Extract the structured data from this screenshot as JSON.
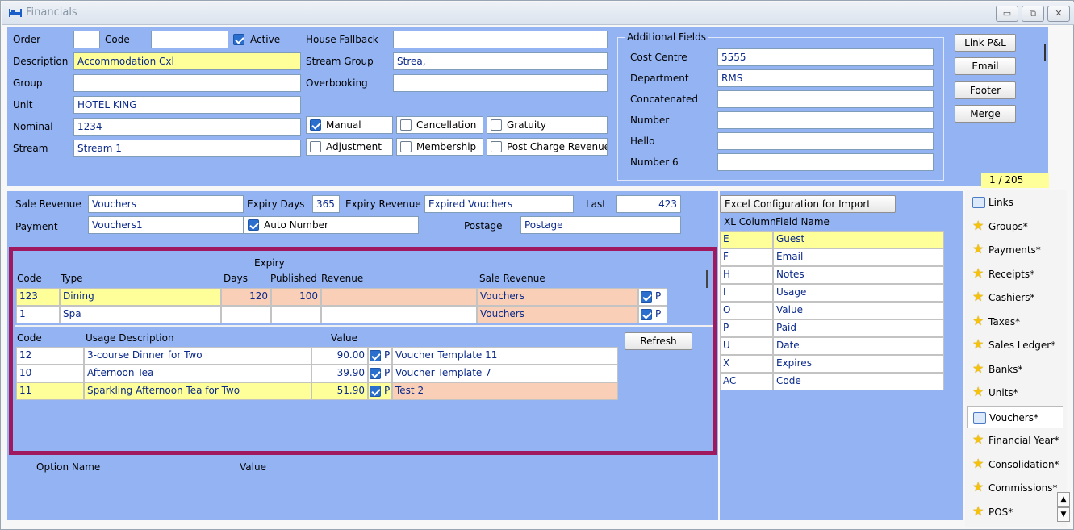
{
  "window": {
    "title": "Financials",
    "minimize": "▭",
    "restore": "⧉",
    "close": "✕"
  },
  "top": {
    "order_label": "Order",
    "order_value": "",
    "code_label": "Code",
    "code_value": "",
    "active_label": "Active",
    "description_label": "Description",
    "description_value": "Accommodation Cxl",
    "group_label": "Group",
    "group_value": "",
    "unit_label": "Unit",
    "unit_value": "HOTEL KING",
    "nominal_label": "Nominal",
    "nominal_value": "1234",
    "stream_label": "Stream",
    "stream_value": "Stream 1",
    "house_fallback_label": "House Fallback",
    "house_fallback_value": "",
    "stream_group_label": "Stream Group",
    "stream_group_value": "Strea,",
    "overbooking_label": "Overbooking",
    "overbooking_value": "",
    "manual_label": "Manual",
    "cancellation_label": "Cancellation",
    "gratuity_label": "Gratuity",
    "adjustment_label": "Adjustment",
    "membership_label": "Membership",
    "post_charge_label": "Post Charge Revenue"
  },
  "additional": {
    "title": "Additional Fields",
    "fields": [
      {
        "label": "Cost Centre",
        "value": "5555"
      },
      {
        "label": "Department",
        "value": "RMS"
      },
      {
        "label": "Concatenated",
        "value": ""
      },
      {
        "label": "Number",
        "value": ""
      },
      {
        "label": "Hello",
        "value": ""
      },
      {
        "label": "Number 6",
        "value": ""
      }
    ]
  },
  "side_buttons": {
    "link_pl": "Link P&L",
    "email": "Email",
    "footer": "Footer",
    "merge": "Merge",
    "record": "1 / 205"
  },
  "voucher": {
    "sale_revenue_label": "Sale Revenue",
    "sale_revenue_value": "Vouchers",
    "expiry_days_label": "Expiry Days",
    "expiry_days_value": "365",
    "expiry_revenue_label": "Expiry Revenue",
    "expiry_revenue_value": "Expired Vouchers",
    "last_label": "Last",
    "last_value": "423",
    "payment_label": "Payment",
    "payment_value": "Vouchers1",
    "auto_number_label": "Auto Number",
    "postage_label": "Postage",
    "postage_value": "Postage"
  },
  "types_grid": {
    "headers": {
      "expiry": "Expiry",
      "code": "Code",
      "type": "Type",
      "days": "Days",
      "published": "Published",
      "revenue": "Revenue",
      "sale_revenue": "Sale Revenue"
    },
    "rows": [
      {
        "code": "123",
        "type": "Dining",
        "days": "120",
        "published": "100",
        "revenue": "",
        "sale_revenue": "Vouchers",
        "p": "P"
      },
      {
        "code": "1",
        "type": "Spa",
        "days": "",
        "published": "",
        "revenue": "",
        "sale_revenue": "Vouchers",
        "p": "P"
      }
    ]
  },
  "usage_grid": {
    "headers": {
      "code": "Code",
      "usage": "Usage Description",
      "value": "Value"
    },
    "refresh": "Refresh",
    "rows": [
      {
        "code": "12",
        "usage": "3-course Dinner for Two",
        "value": "90.00",
        "p": "P",
        "template": "Voucher Template 11"
      },
      {
        "code": "10",
        "usage": "Afternoon Tea",
        "value": "39.90",
        "p": "P",
        "template": "Voucher Template 7"
      },
      {
        "code": "11",
        "usage": "Sparkling Afternoon Tea for Two",
        "value": "51.90",
        "p": "P",
        "template": "Test 2"
      }
    ]
  },
  "options": {
    "name_header": "Option Name",
    "value_header": "Value"
  },
  "excel": {
    "title": "Excel Configuration for Import",
    "col_header": "XL Column",
    "field_header": "Field Name",
    "rows": [
      {
        "col": "E",
        "field": "Guest"
      },
      {
        "col": "F",
        "field": "Email"
      },
      {
        "col": "H",
        "field": "Notes"
      },
      {
        "col": "I",
        "field": "Usage"
      },
      {
        "col": "O",
        "field": "Value"
      },
      {
        "col": "P",
        "field": "Paid"
      },
      {
        "col": "U",
        "field": "Date"
      },
      {
        "col": "X",
        "field": "Expires"
      },
      {
        "col": "AC",
        "field": "Code"
      }
    ]
  },
  "tabs": [
    {
      "label": "Links",
      "icon": "links-icon"
    },
    {
      "label": "Groups*",
      "icon": "star-icon"
    },
    {
      "label": "Payments*",
      "icon": "star-icon"
    },
    {
      "label": "Receipts*",
      "icon": "star-icon"
    },
    {
      "label": "Cashiers*",
      "icon": "star-icon"
    },
    {
      "label": "Taxes*",
      "icon": "star-icon"
    },
    {
      "label": "Sales Ledger*",
      "icon": "star-icon"
    },
    {
      "label": "Banks*",
      "icon": "star-icon"
    },
    {
      "label": "Units*",
      "icon": "star-icon"
    },
    {
      "label": "Vouchers*",
      "icon": "links-icon"
    },
    {
      "label": "Financial Year*",
      "icon": "star-icon"
    },
    {
      "label": "Consolidation*",
      "icon": "star-icon"
    },
    {
      "label": "Commissions*",
      "icon": "star-icon"
    },
    {
      "label": "POS*",
      "icon": "star-icon"
    }
  ],
  "colors": {
    "panel": "#93b3f3",
    "highlight_yellow": "#ffff99",
    "peach": "#f9cfb8",
    "selection_border": "#a0185e"
  }
}
